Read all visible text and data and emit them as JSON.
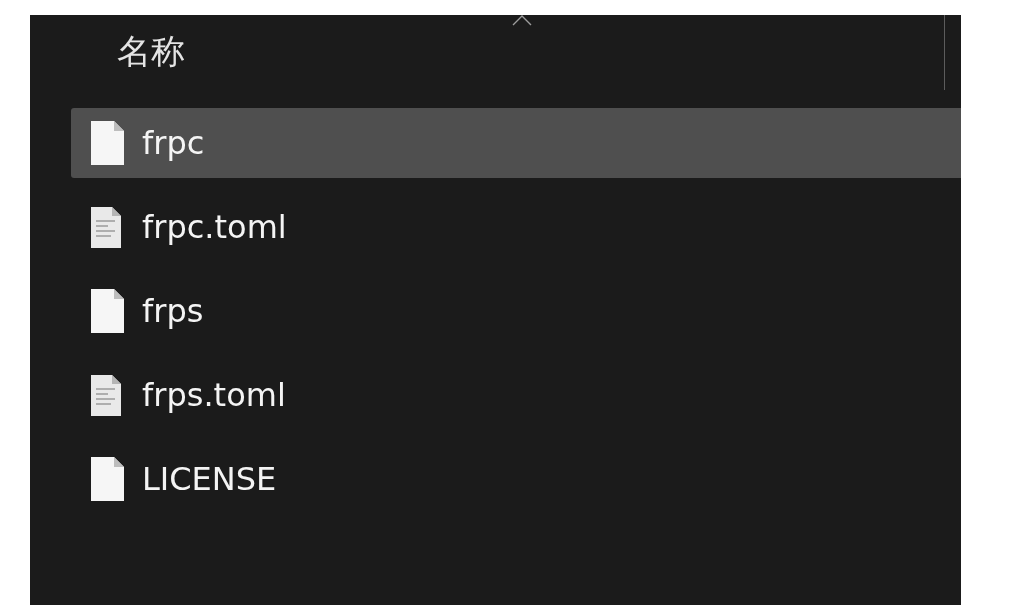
{
  "header": {
    "label": "名称",
    "sorted_ascending": true
  },
  "files": [
    {
      "name": "frpc",
      "kind": "file",
      "selected": true
    },
    {
      "name": "frpc.toml",
      "kind": "text",
      "selected": false
    },
    {
      "name": "frps",
      "kind": "file",
      "selected": false
    },
    {
      "name": "frps.toml",
      "kind": "text",
      "selected": false
    },
    {
      "name": "LICENSE",
      "kind": "file",
      "selected": false
    }
  ]
}
